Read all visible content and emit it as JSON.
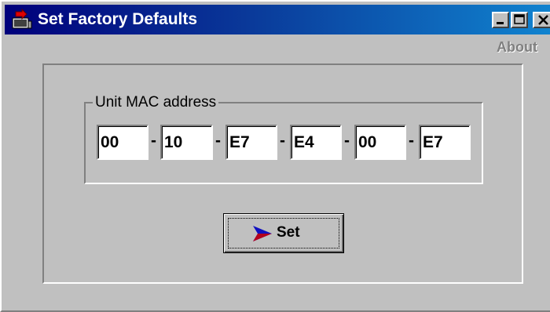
{
  "window": {
    "title": "Set Factory Defaults",
    "icon": "app-icon",
    "controls": [
      "minimize-icon",
      "maximize-icon",
      "close-icon"
    ]
  },
  "menu": {
    "about_label": "About"
  },
  "mac_group": {
    "label": "Unit MAC address",
    "separator": "-",
    "octets": [
      "00",
      "10",
      "E7",
      "E4",
      "00",
      "E7"
    ]
  },
  "actions": {
    "set_label": "Set",
    "set_icon": "arrow-right-icon"
  },
  "colors": {
    "titlebar_start": "#00007b",
    "titlebar_end": "#1084d0",
    "face": "#c0c0c0",
    "arrow_blue": "#1010c0",
    "arrow_red": "#d00000"
  }
}
